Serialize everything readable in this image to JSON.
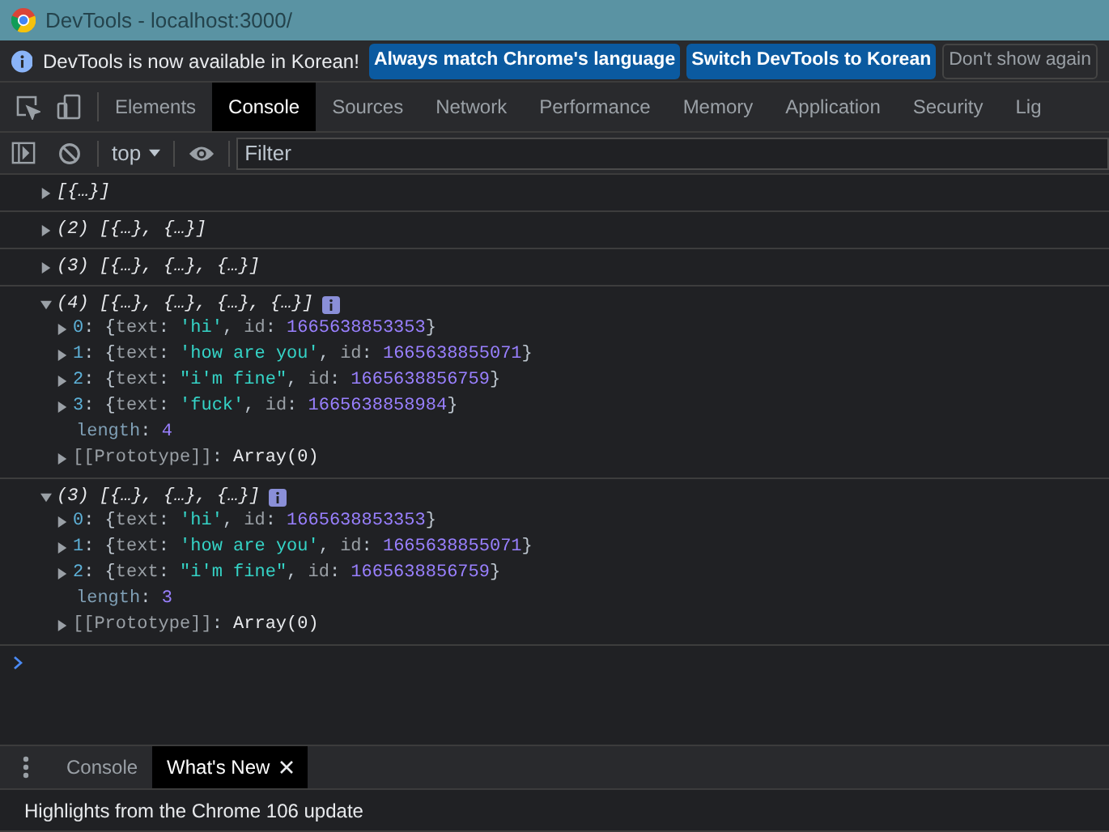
{
  "window": {
    "title": "DevTools - localhost:3000/"
  },
  "infobar": {
    "message": "DevTools is now available in Korean!",
    "buttons": [
      {
        "label": "Always match Chrome's language",
        "kind": "primary"
      },
      {
        "label": "Switch DevTools to Korean",
        "kind": "primary"
      },
      {
        "label": "Don't show again",
        "kind": "secondary"
      }
    ]
  },
  "tabs": [
    {
      "label": "Elements",
      "selected": false
    },
    {
      "label": "Console",
      "selected": true
    },
    {
      "label": "Sources",
      "selected": false
    },
    {
      "label": "Network",
      "selected": false
    },
    {
      "label": "Performance",
      "selected": false
    },
    {
      "label": "Memory",
      "selected": false
    },
    {
      "label": "Application",
      "selected": false
    },
    {
      "label": "Security",
      "selected": false
    },
    {
      "label": "Lig",
      "selected": false
    }
  ],
  "console_toolbar": {
    "context": "top",
    "filter": {
      "placeholder": "Filter"
    }
  },
  "log": [
    {
      "summary": "[{…}]",
      "expanded": false
    },
    {
      "count": "(2)",
      "summary": "[{…}, {…}]",
      "expanded": false
    },
    {
      "count": "(3)",
      "summary": "[{…}, {…}, {…}]",
      "expanded": false
    },
    {
      "count": "(4)",
      "summary": "[{…}, {…}, {…}, {…}]",
      "expanded": true,
      "children": [
        {
          "expandable": true,
          "tokens": [
            {
              "kind": "key",
              "text": "0"
            },
            {
              "kind": "punct",
              "text": ": {"
            },
            {
              "kind": "name",
              "text": "text"
            },
            {
              "kind": "punct",
              "text": ": "
            },
            {
              "kind": "string",
              "text": "'hi'"
            },
            {
              "kind": "punct",
              "text": ", "
            },
            {
              "kind": "name",
              "text": "id"
            },
            {
              "kind": "punct",
              "text": ": "
            },
            {
              "kind": "number",
              "text": "1665638853353"
            },
            {
              "kind": "punct",
              "text": "}"
            }
          ]
        },
        {
          "expandable": true,
          "tokens": [
            {
              "kind": "key",
              "text": "1"
            },
            {
              "kind": "punct",
              "text": ": {"
            },
            {
              "kind": "name",
              "text": "text"
            },
            {
              "kind": "punct",
              "text": ": "
            },
            {
              "kind": "string",
              "text": "'how are you'"
            },
            {
              "kind": "punct",
              "text": ", "
            },
            {
              "kind": "name",
              "text": "id"
            },
            {
              "kind": "punct",
              "text": ": "
            },
            {
              "kind": "number",
              "text": "1665638855071"
            },
            {
              "kind": "punct",
              "text": "}"
            }
          ]
        },
        {
          "expandable": true,
          "tokens": [
            {
              "kind": "key",
              "text": "2"
            },
            {
              "kind": "punct",
              "text": ": {"
            },
            {
              "kind": "name",
              "text": "text"
            },
            {
              "kind": "punct",
              "text": ": "
            },
            {
              "kind": "string",
              "text": "\"i'm fine\""
            },
            {
              "kind": "punct",
              "text": ", "
            },
            {
              "kind": "name",
              "text": "id"
            },
            {
              "kind": "punct",
              "text": ": "
            },
            {
              "kind": "number",
              "text": "1665638856759"
            },
            {
              "kind": "punct",
              "text": "}"
            }
          ]
        },
        {
          "expandable": true,
          "tokens": [
            {
              "kind": "key",
              "text": "3"
            },
            {
              "kind": "punct",
              "text": ": {"
            },
            {
              "kind": "name",
              "text": "text"
            },
            {
              "kind": "punct",
              "text": ": "
            },
            {
              "kind": "string",
              "text": "'fuck'"
            },
            {
              "kind": "punct",
              "text": ", "
            },
            {
              "kind": "name",
              "text": "id"
            },
            {
              "kind": "punct",
              "text": ": "
            },
            {
              "kind": "number",
              "text": "1665638858984"
            },
            {
              "kind": "punct",
              "text": "}"
            }
          ]
        },
        {
          "expandable": false,
          "tokens": [
            {
              "kind": "meta",
              "text": "length"
            },
            {
              "kind": "punct",
              "text": ": "
            },
            {
              "kind": "number",
              "text": "4"
            }
          ]
        },
        {
          "expandable": true,
          "tokens": [
            {
              "kind": "name",
              "text": "[[Prototype]]"
            },
            {
              "kind": "punct",
              "text": ": "
            },
            {
              "kind": "plain",
              "text": "Array(0)"
            }
          ]
        }
      ]
    },
    {
      "count": "(3)",
      "summary": "[{…}, {…}, {…}]",
      "expanded": true,
      "children": [
        {
          "expandable": true,
          "tokens": [
            {
              "kind": "key",
              "text": "0"
            },
            {
              "kind": "punct",
              "text": ": {"
            },
            {
              "kind": "name",
              "text": "text"
            },
            {
              "kind": "punct",
              "text": ": "
            },
            {
              "kind": "string",
              "text": "'hi'"
            },
            {
              "kind": "punct",
              "text": ", "
            },
            {
              "kind": "name",
              "text": "id"
            },
            {
              "kind": "punct",
              "text": ": "
            },
            {
              "kind": "number",
              "text": "1665638853353"
            },
            {
              "kind": "punct",
              "text": "}"
            }
          ]
        },
        {
          "expandable": true,
          "tokens": [
            {
              "kind": "key",
              "text": "1"
            },
            {
              "kind": "punct",
              "text": ": {"
            },
            {
              "kind": "name",
              "text": "text"
            },
            {
              "kind": "punct",
              "text": ": "
            },
            {
              "kind": "string",
              "text": "'how are you'"
            },
            {
              "kind": "punct",
              "text": ", "
            },
            {
              "kind": "name",
              "text": "id"
            },
            {
              "kind": "punct",
              "text": ": "
            },
            {
              "kind": "number",
              "text": "1665638855071"
            },
            {
              "kind": "punct",
              "text": "}"
            }
          ]
        },
        {
          "expandable": true,
          "tokens": [
            {
              "kind": "key",
              "text": "2"
            },
            {
              "kind": "punct",
              "text": ": {"
            },
            {
              "kind": "name",
              "text": "text"
            },
            {
              "kind": "punct",
              "text": ": "
            },
            {
              "kind": "string",
              "text": "\"i'm fine\""
            },
            {
              "kind": "punct",
              "text": ", "
            },
            {
              "kind": "name",
              "text": "id"
            },
            {
              "kind": "punct",
              "text": ": "
            },
            {
              "kind": "number",
              "text": "1665638856759"
            },
            {
              "kind": "punct",
              "text": "}"
            }
          ]
        },
        {
          "expandable": false,
          "tokens": [
            {
              "kind": "meta",
              "text": "length"
            },
            {
              "kind": "punct",
              "text": ": "
            },
            {
              "kind": "number",
              "text": "3"
            }
          ]
        },
        {
          "expandable": true,
          "tokens": [
            {
              "kind": "name",
              "text": "[[Prototype]]"
            },
            {
              "kind": "punct",
              "text": ": "
            },
            {
              "kind": "plain",
              "text": "Array(0)"
            }
          ]
        }
      ]
    }
  ],
  "drawer": {
    "tabs": [
      {
        "label": "Console",
        "selected": false,
        "closable": false
      },
      {
        "label": "What's New",
        "selected": true,
        "closable": true
      }
    ],
    "content": "Highlights from the Chrome 106 update"
  }
}
